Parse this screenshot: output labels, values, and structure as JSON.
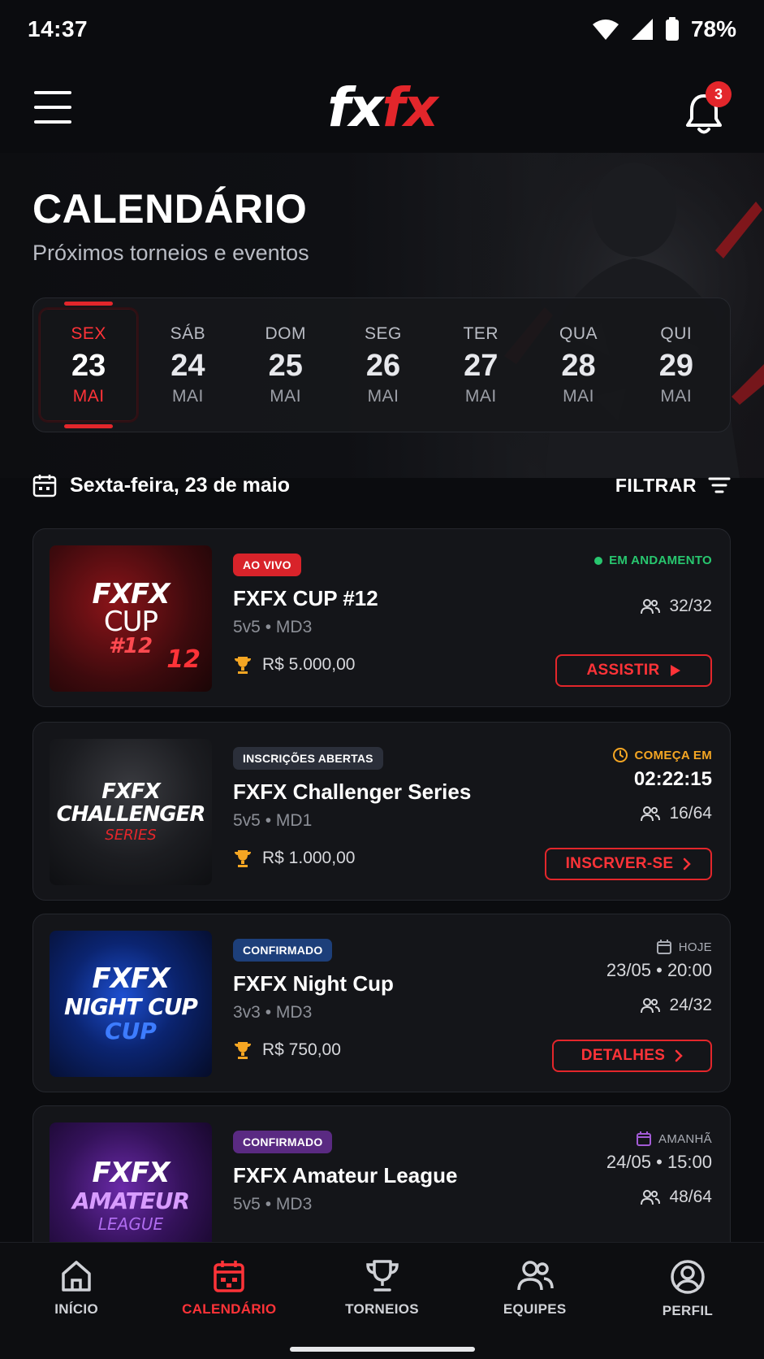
{
  "status_bar": {
    "time": "14:37",
    "battery": "78%"
  },
  "header": {
    "logo_part1": "fx",
    "logo_part2": "fx",
    "notification_count": "3"
  },
  "page": {
    "title": "CALENDÁRIO",
    "subtitle": "Próximos torneios e eventos"
  },
  "dates": [
    {
      "dow": "SEX",
      "num": "23",
      "mon": "MAI",
      "active": true
    },
    {
      "dow": "SÁB",
      "num": "24",
      "mon": "MAI"
    },
    {
      "dow": "DOM",
      "num": "25",
      "mon": "MAI"
    },
    {
      "dow": "SEG",
      "num": "26",
      "mon": "MAI"
    },
    {
      "dow": "TER",
      "num": "27",
      "mon": "MAI"
    },
    {
      "dow": "QUA",
      "num": "28",
      "mon": "MAI"
    },
    {
      "dow": "QUI",
      "num": "29",
      "mon": "MAI"
    }
  ],
  "day_header": {
    "label": "Sexta-feira, 23 de maio",
    "filter_label": "FILTRAR"
  },
  "events": [
    {
      "thumb": {
        "line1": "FXFX",
        "line2": "CUP",
        "line3": "#12",
        "extra": "12"
      },
      "badge": "AO VIVO",
      "name": "FXFX CUP #12",
      "format": "5v5",
      "series": "MD3",
      "prize": "R$ 5.000,00",
      "status": "EM ANDAMENTO",
      "players": "32/32",
      "action": "ASSISTIR"
    },
    {
      "thumb": {
        "line1": "FXFX",
        "line2": "CHALLENGER",
        "line3": "SERIES"
      },
      "badge": "INSCRIÇÕES ABERTAS",
      "name": "FXFX Challenger Series",
      "format": "5v5",
      "series": "MD1",
      "prize": "R$ 1.000,00",
      "status": "COMEÇA EM",
      "countdown": "02:22:15",
      "players": "16/64",
      "action": "INSCRVER-SE"
    },
    {
      "thumb": {
        "line1": "FXFX",
        "line2": "NIGHT CUP",
        "line3": "CUP"
      },
      "badge": "CONFIRMADO",
      "name": "FXFX Night Cup",
      "format": "3v3",
      "series": "MD3",
      "prize": "R$ 750,00",
      "status": "HOJE",
      "date": "23/05",
      "time": "20:00",
      "players": "24/32",
      "action": "DETALHES"
    },
    {
      "thumb": {
        "line1": "FXFX",
        "line2": "AMATEUR",
        "line3": "LEAGUE"
      },
      "badge": "CONFIRMADO",
      "name": "FXFX Amateur League",
      "format": "5v5",
      "series": "MD3",
      "status": "AMANHÃ",
      "date": "24/05",
      "time": "15:00",
      "players": "48/64"
    }
  ],
  "separator": "•",
  "nav": [
    {
      "label": "INÍCIO",
      "icon": "home-icon"
    },
    {
      "label": "CALENDÁRIO",
      "icon": "calendar-icon",
      "active": true
    },
    {
      "label": "TORNEIOS",
      "icon": "trophy-icon"
    },
    {
      "label": "EQUIPES",
      "icon": "users-icon"
    },
    {
      "label": "PERFIL",
      "icon": "user-circle-icon"
    }
  ],
  "colors": {
    "accent": "#e3262b",
    "live_badge": "#d8232a",
    "registration_badge": "#2b2f3a",
    "confirmed_blue": "#1d3f7a",
    "confirmed_purple": "#5a2a82",
    "status_green": "#28c76f",
    "status_amber": "#f5a623",
    "trophy": "#f5a623",
    "background": "#0b0c0f"
  }
}
